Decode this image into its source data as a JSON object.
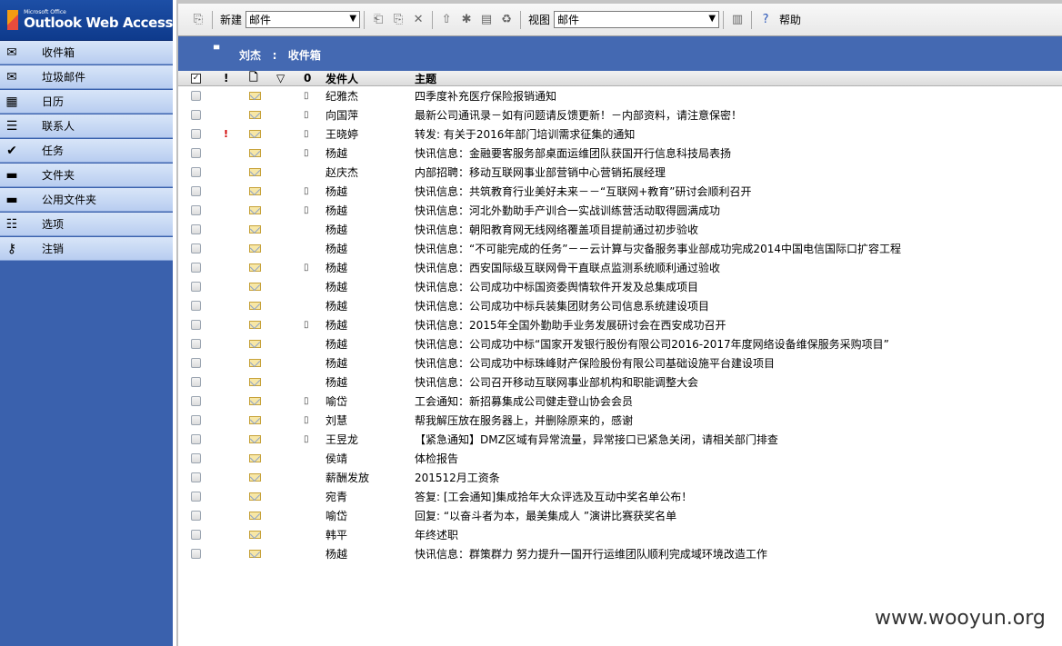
{
  "logo": {
    "small": "Microsoft Office",
    "big": "Outlook Web Access"
  },
  "nav": [
    {
      "label": "收件箱",
      "icon": "inbox-icon",
      "glyph": "✉"
    },
    {
      "label": "垃圾邮件",
      "icon": "junk-mail-icon",
      "glyph": "✉"
    },
    {
      "label": "日历",
      "icon": "calendar-icon",
      "glyph": "▦"
    },
    {
      "label": "联系人",
      "icon": "contacts-icon",
      "glyph": "☰"
    },
    {
      "label": "任务",
      "icon": "tasks-icon",
      "glyph": "✔"
    },
    {
      "label": "文件夹",
      "icon": "folder-icon",
      "glyph": "▬"
    },
    {
      "label": "公用文件夹",
      "icon": "public-folder-icon",
      "glyph": "▬"
    },
    {
      "label": "选项",
      "icon": "options-icon",
      "glyph": "☷"
    },
    {
      "label": "注销",
      "icon": "logoff-icon",
      "glyph": "⚷"
    }
  ],
  "toolbar": {
    "new_label": "新建",
    "new_value": "邮件",
    "view_label": "视图",
    "view_value": "邮件",
    "help_label": "帮助"
  },
  "folder": {
    "user": "刘杰",
    "sep": ":",
    "name": "收件箱"
  },
  "columns": {
    "from": "发件人",
    "subject": "主题",
    "importance": "!",
    "attachment": "0"
  },
  "messages": [
    {
      "from": "纪雅杰",
      "subject": "四季度补充医疗保险报销通知",
      "att": true,
      "imp": false
    },
    {
      "from": "向国萍",
      "subject": "最新公司通讯录－如有问题请反馈更新！－内部资料，请注意保密！",
      "att": true,
      "imp": false
    },
    {
      "from": "王晓婷",
      "subject": "转发: 有关于2016年部门培训需求征集的通知",
      "att": true,
      "imp": true
    },
    {
      "from": "杨越",
      "subject": "快讯信息：金融要客服务部桌面运维团队获国开行信息科技局表扬",
      "att": true,
      "imp": false
    },
    {
      "from": "赵庆杰",
      "subject": "内部招聘：移动互联网事业部营销中心营销拓展经理",
      "att": false,
      "imp": false
    },
    {
      "from": "杨越",
      "subject": "快讯信息：共筑教育行业美好未来－－“互联网+教育”研讨会顺利召开",
      "att": true,
      "imp": false
    },
    {
      "from": "杨越",
      "subject": "快讯信息：河北外勤助手产训合一实战训练营活动取得圆满成功",
      "att": true,
      "imp": false
    },
    {
      "from": "杨越",
      "subject": "快讯信息：朝阳教育网无线网络覆盖项目提前通过初步验收",
      "att": false,
      "imp": false
    },
    {
      "from": "杨越",
      "subject": "快讯信息：“不可能完成的任务”－－云计算与灾备服务事业部成功完成2014中国电信国际口扩容工程",
      "att": false,
      "imp": false
    },
    {
      "from": "杨越",
      "subject": "快讯信息：西安国际级互联网骨干直联点监测系统顺利通过验收",
      "att": true,
      "imp": false
    },
    {
      "from": "杨越",
      "subject": "快讯信息：公司成功中标国资委舆情软件开发及总集成项目",
      "att": false,
      "imp": false
    },
    {
      "from": "杨越",
      "subject": "快讯信息：公司成功中标兵装集团财务公司信息系统建设项目",
      "att": false,
      "imp": false
    },
    {
      "from": "杨越",
      "subject": "快讯信息：2015年全国外勤助手业务发展研讨会在西安成功召开",
      "att": true,
      "imp": false
    },
    {
      "from": "杨越",
      "subject": "快讯信息：公司成功中标“国家开发银行股份有限公司2016-2017年度网络设备维保服务采购项目”",
      "att": false,
      "imp": false
    },
    {
      "from": "杨越",
      "subject": "快讯信息：公司成功中标珠峰财产保险股份有限公司基础设施平台建设项目",
      "att": false,
      "imp": false
    },
    {
      "from": "杨越",
      "subject": "快讯信息：公司召开移动互联网事业部机构和职能调整大会",
      "att": false,
      "imp": false
    },
    {
      "from": "喻岱",
      "subject": "工会通知：新招募集成公司健走登山协会会员",
      "att": true,
      "imp": false
    },
    {
      "from": "刘慧",
      "subject": "帮我解压放在服务器上，并删除原来的，感谢",
      "att": true,
      "imp": false
    },
    {
      "from": "王昱龙",
      "subject": "【紧急通知】DMZ区域有异常流量，异常接口已紧急关闭，请相关部门排查",
      "att": true,
      "imp": false
    },
    {
      "from": "侯靖",
      "subject": "体检报告",
      "att": false,
      "imp": false
    },
    {
      "from": "薪酬发放",
      "subject": "201512月工资条",
      "att": false,
      "imp": false
    },
    {
      "from": "宛青",
      "subject": "答复: [工会通知]集成拾年大众评选及互动中奖名单公布！",
      "att": false,
      "imp": false
    },
    {
      "from": "喻岱",
      "subject": "回复: “以奋斗者为本，最美集成人 ”演讲比赛获奖名单",
      "att": false,
      "imp": false
    },
    {
      "from": "韩平",
      "subject": "年终述职",
      "att": false,
      "imp": false
    },
    {
      "from": "杨越",
      "subject": "快讯信息：群策群力 努力提升一国开行运维团队顺利完成域环境改造工作",
      "att": false,
      "imp": false
    }
  ],
  "watermark": "www.wooyun.org"
}
